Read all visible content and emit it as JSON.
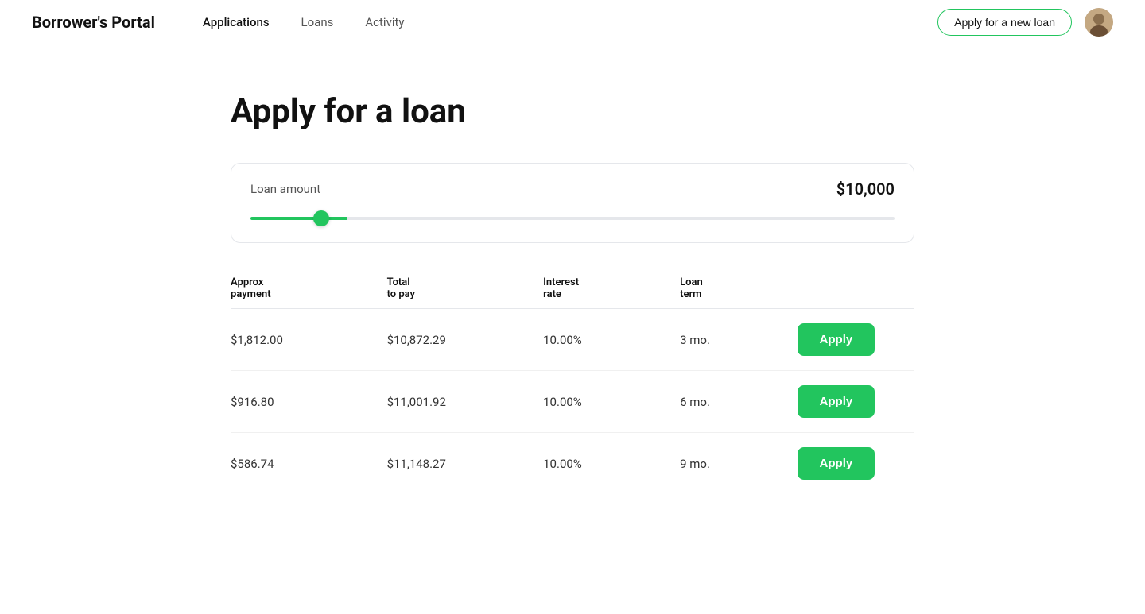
{
  "brand": "Borrower's Portal",
  "nav": {
    "links": [
      {
        "label": "Applications",
        "active": true
      },
      {
        "label": "Loans",
        "active": false
      },
      {
        "label": "Activity",
        "active": false
      }
    ],
    "apply_btn_label": "Apply for a new loan"
  },
  "page": {
    "title": "Apply for a loan"
  },
  "loan_amount": {
    "label": "Loan amount",
    "value": "$10,000",
    "slider_min": 0,
    "slider_max": 100000,
    "slider_current": 10000
  },
  "table": {
    "headers": [
      {
        "key": "approx_payment",
        "label1": "Approx",
        "label2": "payment"
      },
      {
        "key": "total_to_pay",
        "label1": "Total",
        "label2": "to pay"
      },
      {
        "key": "interest_rate",
        "label1": "Interest",
        "label2": "rate"
      },
      {
        "key": "loan_term",
        "label1": "Loan",
        "label2": "term"
      },
      {
        "key": "action",
        "label1": "",
        "label2": ""
      }
    ],
    "rows": [
      {
        "approx_payment": "$1,812.00",
        "total_to_pay": "$10,872.29",
        "interest_rate": "10.00%",
        "loan_term": "3 mo.",
        "apply_label": "Apply"
      },
      {
        "approx_payment": "$916.80",
        "total_to_pay": "$11,001.92",
        "interest_rate": "10.00%",
        "loan_term": "6 mo.",
        "apply_label": "Apply"
      },
      {
        "approx_payment": "$586.74",
        "total_to_pay": "$11,148.27",
        "interest_rate": "10.00%",
        "loan_term": "9 mo.",
        "apply_label": "Apply"
      }
    ]
  }
}
